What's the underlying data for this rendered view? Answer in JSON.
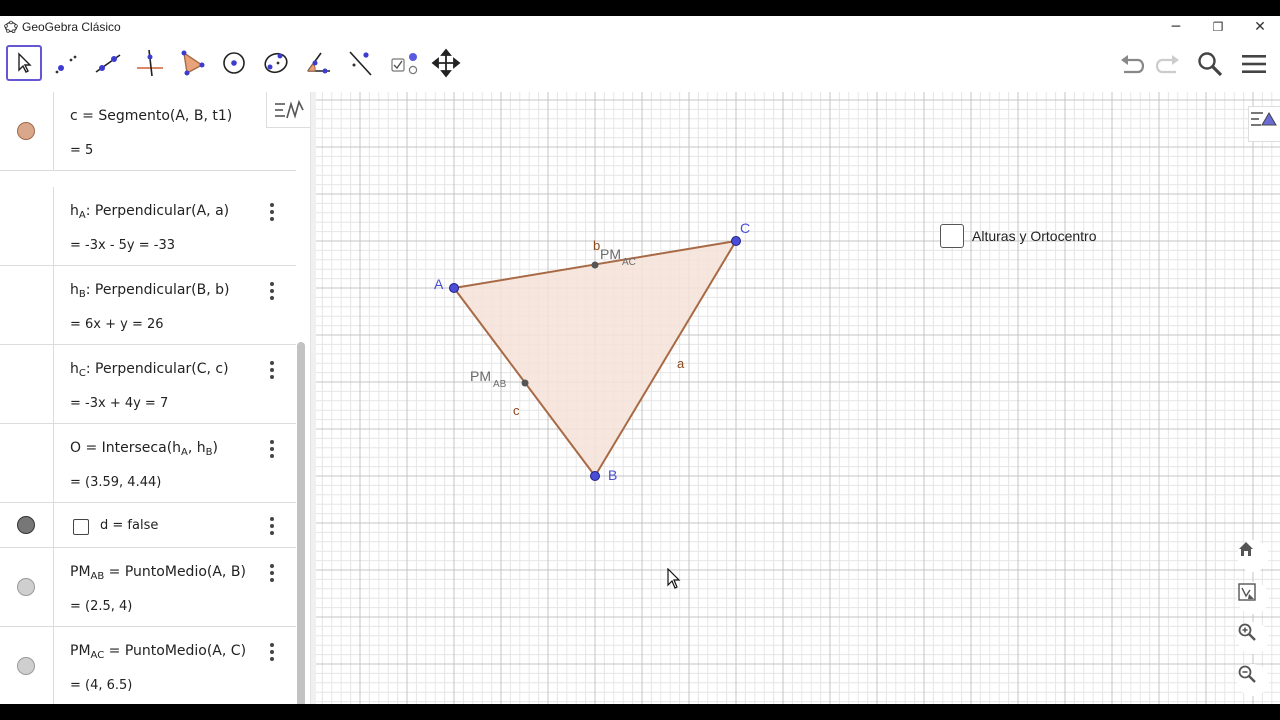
{
  "window": {
    "title": "GeoGebra Clásico",
    "controls": {
      "minimize": "─",
      "restore": "❐",
      "close": "✕"
    }
  },
  "toolbar": {
    "tools": [
      {
        "name": "move-tool",
        "icon": "arrow-pointer-icon",
        "selected": true
      },
      {
        "name": "point-tool",
        "icon": "point-icon"
      },
      {
        "name": "line-tool",
        "icon": "line-icon"
      },
      {
        "name": "perpendicular-tool",
        "icon": "perpendicular-icon"
      },
      {
        "name": "polygon-tool",
        "icon": "polygon-icon"
      },
      {
        "name": "circle-tool",
        "icon": "circle-icon"
      },
      {
        "name": "conic-tool",
        "icon": "ellipse-icon"
      },
      {
        "name": "angle-tool",
        "icon": "angle-icon"
      },
      {
        "name": "reflect-tool",
        "icon": "reflect-icon"
      },
      {
        "name": "checkbox-tool",
        "icon": "checkbox-slider-icon"
      },
      {
        "name": "move-graphics-tool",
        "icon": "move-arrows-icon"
      }
    ],
    "right": [
      "undo-icon",
      "redo-icon",
      "search-icon",
      "menu-icon"
    ]
  },
  "algebra": {
    "rows": [
      {
        "def_pre": "c = Segmento(A, B, t1)",
        "value": "= 5",
        "dot_color": "#d9a88a",
        "dot_border": "#a0684a",
        "kebab": false
      },
      {
        "def_pre": "h",
        "def_sub": "A",
        "def_post": ": Perpendicular(A, a)",
        "value": "= -3x - 5y = -33",
        "kebab": true
      },
      {
        "def_pre": "h",
        "def_sub": "B",
        "def_post": ": Perpendicular(B, b)",
        "value": "= 6x + y = 26",
        "kebab": true
      },
      {
        "def_pre": "h",
        "def_sub": "C",
        "def_post": ": Perpendicular(C, c)",
        "value": "= -3x + 4y = 7",
        "kebab": true
      },
      {
        "def_pre": "O = Interseca(h",
        "def_sub": "A",
        "def_mid": ", h",
        "def_sub2": "B",
        "def_post": ")",
        "value": "= (3.59, 4.44)",
        "kebab": true
      },
      {
        "def_pre": "d = false",
        "checkbox": true,
        "dot_color": "#777777",
        "dot_border": "#333333",
        "kebab": true
      },
      {
        "def_pre": "PM",
        "def_sub": "AB",
        "def_post": " = PuntoMedio(A, B)",
        "value": "= (2.5, 4)",
        "dot_color": "#cfcfcf",
        "dot_border": "#9a9a9a",
        "kebab": true
      },
      {
        "def_pre": "PM",
        "def_sub": "AC",
        "def_post": " = PuntoMedio(A, C)",
        "value": "= (4, 6.5)",
        "dot_color": "#cfcfcf",
        "dot_border": "#9a9a9a",
        "kebab": true
      }
    ]
  },
  "graphics": {
    "checkbox_label": "Alturas y Ortocentro",
    "labels": {
      "A": "A",
      "B": "B",
      "C": "C",
      "a": "a",
      "b": "b",
      "c": "c",
      "pm_ab": "PM",
      "pm_ab_sub": "AB",
      "pm_ac": "PM",
      "pm_ac_sub": "AC"
    },
    "colors": {
      "grid_minor": "#e6e6e6",
      "grid_major": "#c4c4c4",
      "triangle_fill": "#f6e2d8",
      "triangle_edge": "#a86a45",
      "vertex_point": "#4a4ed6",
      "midpoint": "#555555",
      "accent": "#6557d2"
    },
    "side_buttons": [
      "home-icon",
      "graphics-view-icon",
      "zoom-in-icon",
      "zoom-out-icon"
    ]
  }
}
